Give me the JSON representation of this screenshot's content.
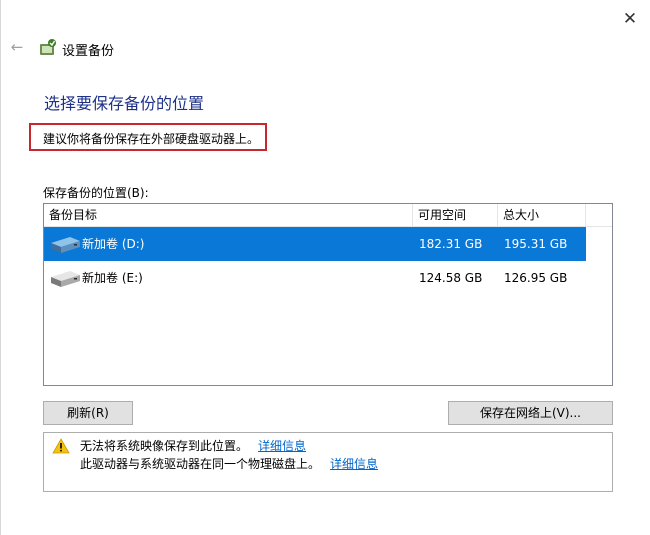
{
  "window": {
    "title": "设置备份",
    "close_glyph": "✕",
    "back_glyph": "←"
  },
  "page": {
    "heading": "选择要保存备份的位置",
    "recommendation": "建议你将备份保存在外部硬盘驱动器上。",
    "list_label": "保存备份的位置(B):"
  },
  "list": {
    "columns": [
      "备份目标",
      "可用空间",
      "总大小"
    ],
    "rows": [
      {
        "name": "新加卷 (D:)",
        "free": "182.31 GB",
        "total": "195.31 GB",
        "selected": true,
        "icon": "drive-icon"
      },
      {
        "name": "新加卷 (E:)",
        "free": "124.58 GB",
        "total": "126.95 GB",
        "selected": false,
        "icon": "drive-icon"
      }
    ]
  },
  "buttons": {
    "refresh": "刷新(R)",
    "save_network": "保存在网络上(V)..."
  },
  "notice": {
    "line1": "无法将系统映像保存到此位置。",
    "line1_link": "详细信息",
    "line2": "此驱动器与系统驱动器在同一个物理磁盘上。",
    "line2_link": "详细信息",
    "icon": "warning-icon"
  },
  "colors": {
    "heading": "#1e3287",
    "selection": "#0a78d7",
    "highlight_border": "#c8282d",
    "link": "#0066cc"
  }
}
